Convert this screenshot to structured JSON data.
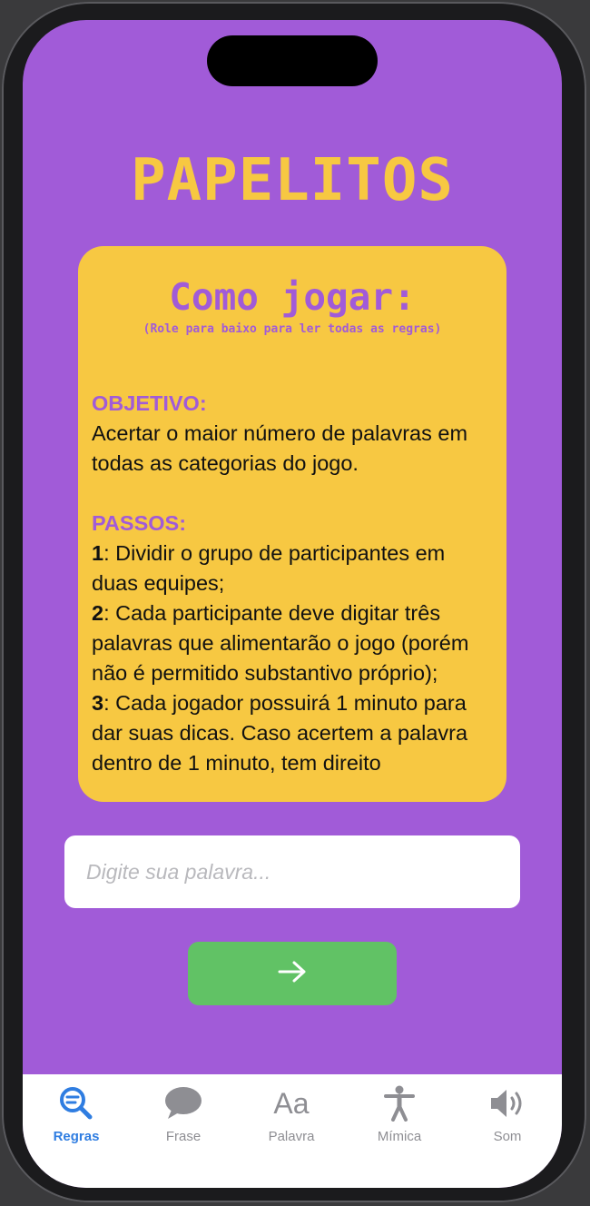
{
  "app": {
    "title": "PAPELITOS"
  },
  "rules": {
    "heading": "Como jogar:",
    "hint": "(Role para baixo para ler todas as regras)",
    "objective_label": "OBJETIVO:",
    "objective_text": "Acertar o maior número de palavras em todas as categorias do jogo.",
    "steps_label": "PASSOS:",
    "steps": [
      {
        "num": "1",
        "text": ": Dividir o grupo de participantes em duas equipes;"
      },
      {
        "num": "2",
        "text": ": Cada participante deve digitar três palavras que alimentarão o jogo (porém não é permitido substantivo próprio);"
      },
      {
        "num": "3",
        "text": ": Cada jogador possuirá 1 minuto para dar suas dicas. Caso acertem a palavra dentro de 1 minuto, tem direito"
      }
    ]
  },
  "input": {
    "placeholder": "Digite sua palavra...",
    "value": ""
  },
  "next_button": {
    "icon": "arrow-right-icon"
  },
  "tabs": [
    {
      "label": "Regras",
      "icon": "magnifier-icon",
      "active": true
    },
    {
      "label": "Frase",
      "icon": "speech-bubble-icon",
      "active": false
    },
    {
      "label": "Palavra",
      "icon": "text-aa-icon",
      "glyph": "Aa",
      "active": false
    },
    {
      "label": "Mímica",
      "icon": "accessibility-person-icon",
      "active": false
    },
    {
      "label": "Som",
      "icon": "speaker-icon",
      "active": false
    }
  ],
  "colors": {
    "background": "#a15bd8",
    "accent_yellow": "#f7c842",
    "button_green": "#61c265",
    "tab_active": "#2f7de1",
    "tab_inactive": "#8e8e93"
  }
}
